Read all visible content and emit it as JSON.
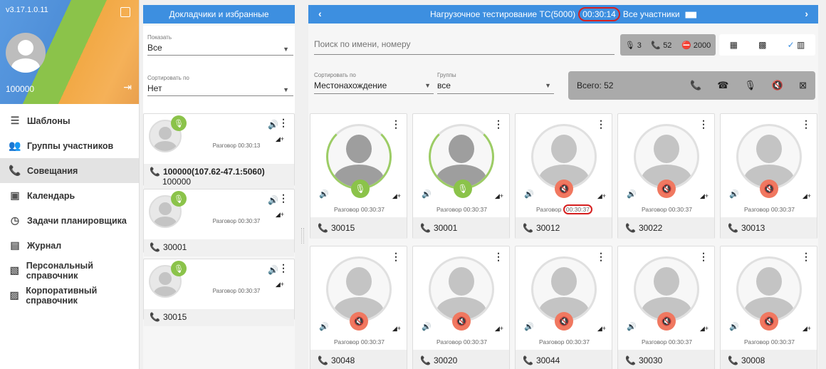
{
  "nav": {
    "version": "v3.17.1.0.11",
    "user_number": "100000",
    "items": [
      {
        "label": "Шаблоны",
        "icon": "list-icon",
        "glyph": "☰",
        "active": false
      },
      {
        "label": "Группы участников",
        "icon": "group-icon",
        "glyph": "👥",
        "active": false
      },
      {
        "label": "Совещания",
        "icon": "phone-icon",
        "glyph": "📞",
        "active": true
      },
      {
        "label": "Календарь",
        "icon": "calendar-icon",
        "glyph": "▣",
        "active": false
      },
      {
        "label": "Задачи планировщика",
        "icon": "clock-icon",
        "glyph": "◷",
        "active": false
      },
      {
        "label": "Журнал",
        "icon": "journal-icon",
        "glyph": "▤",
        "active": false
      },
      {
        "label": "Персональный справочник",
        "icon": "contact-card-icon",
        "glyph": "▧",
        "active": false
      },
      {
        "label": "Корпоративный справочник",
        "icon": "corporate-book-icon",
        "glyph": "▨",
        "active": false
      }
    ]
  },
  "favorites": {
    "title": "Докладчики и избранные",
    "show_label": "Показать",
    "show_value": "Все",
    "sort_label": "Сортировать по",
    "sort_value": "Нет",
    "cards": [
      {
        "status": "Разговор 00:30:13",
        "name": "100000(107.62-47.1:5060)",
        "sub": "100000"
      },
      {
        "status": "Разговор 00:30:37",
        "name": "30001",
        "sub": ""
      },
      {
        "status": "Разговор 00:30:37",
        "name": "30015",
        "sub": ""
      }
    ]
  },
  "conference": {
    "title": "Нагрузочное тестирование ТС(5000)",
    "time": "00:30:14",
    "participants_label": "Все участники",
    "search_placeholder": "Поиск по имени, номеру",
    "stats": {
      "mic": "3",
      "phone": "52",
      "limit": "2000"
    },
    "sort_label": "Сортировать по",
    "sort_value": "Местонахождение",
    "groups_label": "Группы",
    "groups_value": "все",
    "total": "Всего: 52",
    "tiles": [
      {
        "number": "30015",
        "status": "Разговор 00:30:37",
        "mic": "on"
      },
      {
        "number": "30001",
        "status": "Разговор 00:30:37",
        "mic": "on"
      },
      {
        "number": "30012",
        "status_prefix": "Разговор",
        "status_time": "00:30:37",
        "mic": "muted"
      },
      {
        "number": "30022",
        "status": "Разговор 00:30:37",
        "mic": "muted"
      },
      {
        "number": "30013",
        "status": "Разговор 00:30:37",
        "mic": "muted"
      },
      {
        "number": "30048",
        "status": "Разговор 00:30:37",
        "mic": "muted"
      },
      {
        "number": "30020",
        "status": "Разговор 00:30:37",
        "mic": "muted"
      },
      {
        "number": "30044",
        "status": "Разговор 00:30:37",
        "mic": "muted"
      },
      {
        "number": "30030",
        "status": "Разговор 00:30:37",
        "mic": "muted"
      },
      {
        "number": "30008",
        "status": "Разговор 00:30:37",
        "mic": "muted"
      }
    ]
  },
  "colors": {
    "accent": "#3d8fe0",
    "mic_on": "#8bc34a",
    "mic_muted": "#f07860",
    "highlight": "#d62020"
  }
}
